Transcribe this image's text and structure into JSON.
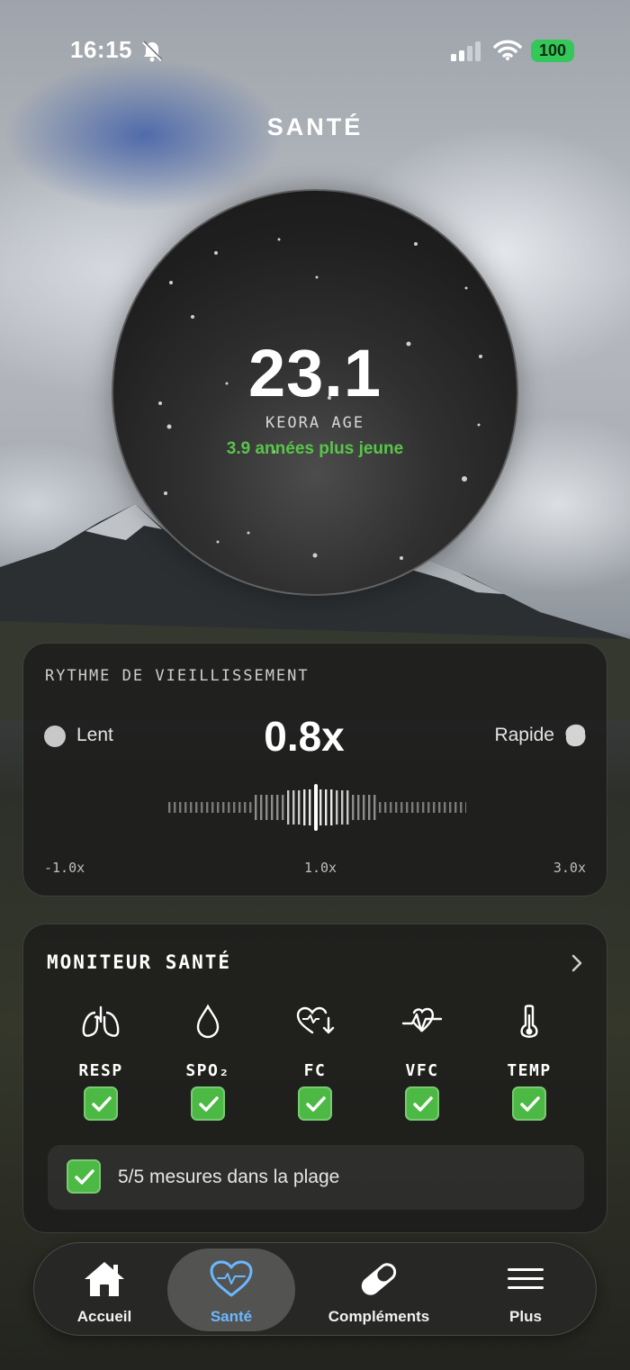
{
  "status_bar": {
    "time": "16:15",
    "battery": "100"
  },
  "header": {
    "title": "SANTÉ"
  },
  "age_orb": {
    "value": "23.1",
    "label": "KEORA AGE",
    "comparison": "3.9 années plus jeune",
    "comparison_color": "#58c54a"
  },
  "aging_pace": {
    "title": "RYTHME DE VIEILLISSEMENT",
    "slow_label": "Lent",
    "fast_label": "Rapide",
    "value": "0.8x",
    "scale": {
      "min": "-1.0x",
      "mid": "1.0x",
      "max": "3.0x"
    }
  },
  "health_monitor": {
    "title": "MONITEUR SANTÉ",
    "metrics": [
      {
        "label": "RESP",
        "icon": "lungs-icon",
        "status": "ok"
      },
      {
        "label": "SPO₂",
        "icon": "drop-icon",
        "status": "ok"
      },
      {
        "label": "FC",
        "icon": "heart-rate-down-icon",
        "status": "ok"
      },
      {
        "label": "VFC",
        "icon": "heart-variability-icon",
        "status": "ok"
      },
      {
        "label": "TEMP",
        "icon": "thermometer-icon",
        "status": "ok"
      }
    ],
    "summary": "5/5 mesures dans la plage",
    "accent_color": "#4cb944"
  },
  "tab_bar": {
    "items": [
      {
        "label": "Accueil",
        "icon": "home-icon"
      },
      {
        "label": "Santé",
        "icon": "heart-pulse-icon",
        "active": true
      },
      {
        "label": "Compléments",
        "icon": "pill-icon"
      },
      {
        "label": "Plus",
        "icon": "menu-icon"
      }
    ],
    "active_color": "#6ab8ff"
  }
}
